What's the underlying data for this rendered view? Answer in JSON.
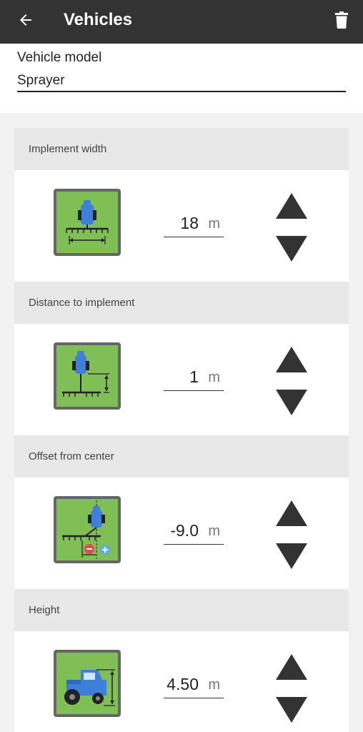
{
  "header": {
    "title": "Vehicles",
    "back_icon": "arrow-left-icon",
    "delete_icon": "trash-icon",
    "background": "#333333"
  },
  "vehicle_model": {
    "label": "Vehicle model",
    "value": "Sprayer"
  },
  "settings": [
    {
      "title": "Implement width",
      "value": "18",
      "unit": "m",
      "icon": "implement-width-illustration"
    },
    {
      "title": "Distance to implement",
      "value": "1",
      "unit": "m",
      "icon": "distance-to-implement-illustration"
    },
    {
      "title": "Offset from center",
      "value": "-9.0",
      "unit": "m",
      "icon": "offset-from-center-illustration"
    },
    {
      "title": "Height",
      "value": "4.50",
      "unit": "m",
      "icon": "tractor-height-illustration"
    }
  ],
  "colors": {
    "field_green": "#7fbf55",
    "tractor_blue": "#3d7fd9",
    "arrow": "#333333",
    "minus_badge": "#e04b4b",
    "plus_badge": "#5aaee0"
  }
}
